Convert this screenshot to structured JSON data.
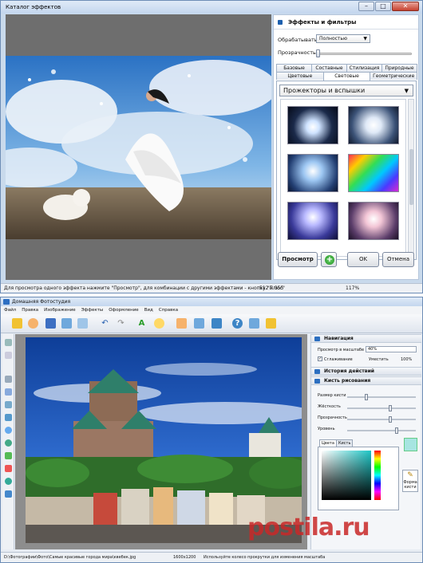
{
  "dialog": {
    "title": "Каталог эффектов",
    "panel_title": "Эффекты и фильтры",
    "process_label": "Обрабатывать",
    "process_value": "Полностью",
    "opacity_label": "Прозрачность",
    "tabs_row1": [
      "Базовые",
      "Составные",
      "Стилизация",
      "Природные"
    ],
    "tabs_row2": [
      "Цветовые",
      "Световые",
      "Геометрические"
    ],
    "active_tab": "Световые",
    "category": "Прожекторы и вспышки",
    "buttons": {
      "preview": "Просмотр",
      "plus": "+",
      "ok": "OK",
      "cancel": "Отмена"
    },
    "status_hint": "Для просмотра одного эффекта нажмите \"Просмотр\", для комбинации с другими эффектами - кнопку \"Плюс\"",
    "status_size": "512 x 355",
    "status_zoom": "117%"
  },
  "app": {
    "title": "Домашняя Фотостудия",
    "menu": [
      "Файл",
      "Правка",
      "Изображение",
      "Эффекты",
      "Оформление",
      "Вид",
      "Справка"
    ],
    "navigation": {
      "title": "Навигация",
      "zoom_label": "Просмотр в масштабе",
      "zoom_value": "40%",
      "smoothing_label": "Сглаживание",
      "fit_label": "Уместить",
      "full_label": "100%"
    },
    "history_title": "История действий",
    "brush": {
      "title": "Кисть рисования",
      "size_label": "Размер кисти",
      "hardness_label": "Жёсткость",
      "opacity_label": "Прозрачность",
      "level_label": "Уровень",
      "tab_color": "Цвета",
      "tab_brush": "Кисть",
      "shape_label": "Форма кисти"
    },
    "status": {
      "path": "D:\\Фотографии\\Фото\\Самые красивые города мира\\квебек.jpg",
      "size": "1600x1200",
      "hint": "Используйте колесо прокрутки для изменения масштаба"
    }
  },
  "watermark": {
    "main": "postila.ru",
    "sub": "postila.ru"
  },
  "colors": {
    "accent": "#1c5fae",
    "plus_green": "#1c8f1c",
    "close_red": "#c7412f"
  }
}
